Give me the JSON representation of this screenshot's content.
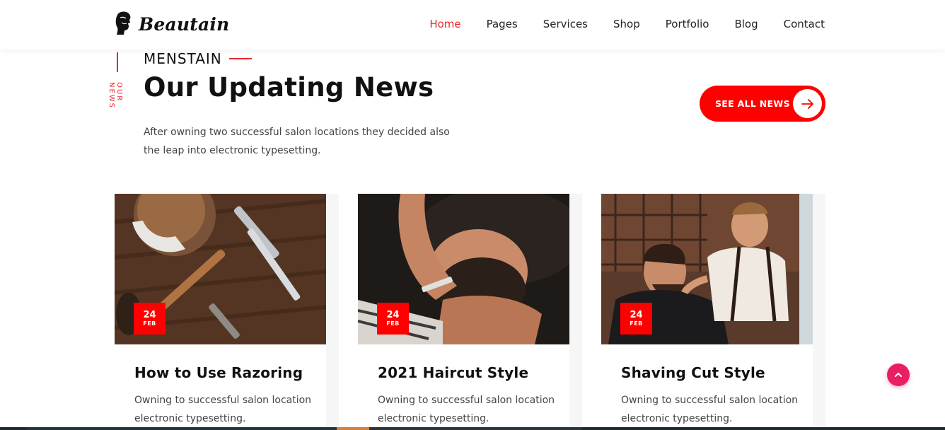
{
  "brand": {
    "name": "Beautain",
    "logo_icon": "barber-head-icon"
  },
  "nav": {
    "items": [
      {
        "label": "Home",
        "active": true
      },
      {
        "label": "Pages",
        "active": false
      },
      {
        "label": "Services",
        "active": false
      },
      {
        "label": "Shop",
        "active": false
      },
      {
        "label": "Portfolio",
        "active": false
      },
      {
        "label": "Blog",
        "active": false
      },
      {
        "label": "Contact",
        "active": false
      }
    ]
  },
  "section": {
    "vertical_label": "OUR NEWS",
    "subtitle": "MENSTAIN",
    "title": "Our Updating News",
    "description": "After owning two successful salon locations they decided also the leap into electronic typesetting.",
    "cta_label": "SEE ALL NEWS",
    "cta_icon": "arrow-right-icon"
  },
  "cards": [
    {
      "day": "24",
      "month": "FEB",
      "title": "How to Use Razoring",
      "text": "Owning to successful salon location electronic typesetting.",
      "image": "barber-tools-photo"
    },
    {
      "day": "24",
      "month": "FEB",
      "title": "2021 Haircut Style",
      "text": "Owning to successful salon location electronic typesetting.",
      "image": "beard-shave-photo"
    },
    {
      "day": "24",
      "month": "FEB",
      "title": "Shaving Cut Style",
      "text": "Owning to successful salon location electronic typesetting.",
      "image": "barbershop-trim-photo"
    }
  ],
  "scroll_top_icon": "chevron-up-icon",
  "colors": {
    "accent": "#e8282b",
    "cta": "#ff0000",
    "scroll_top": "#e91e63"
  }
}
